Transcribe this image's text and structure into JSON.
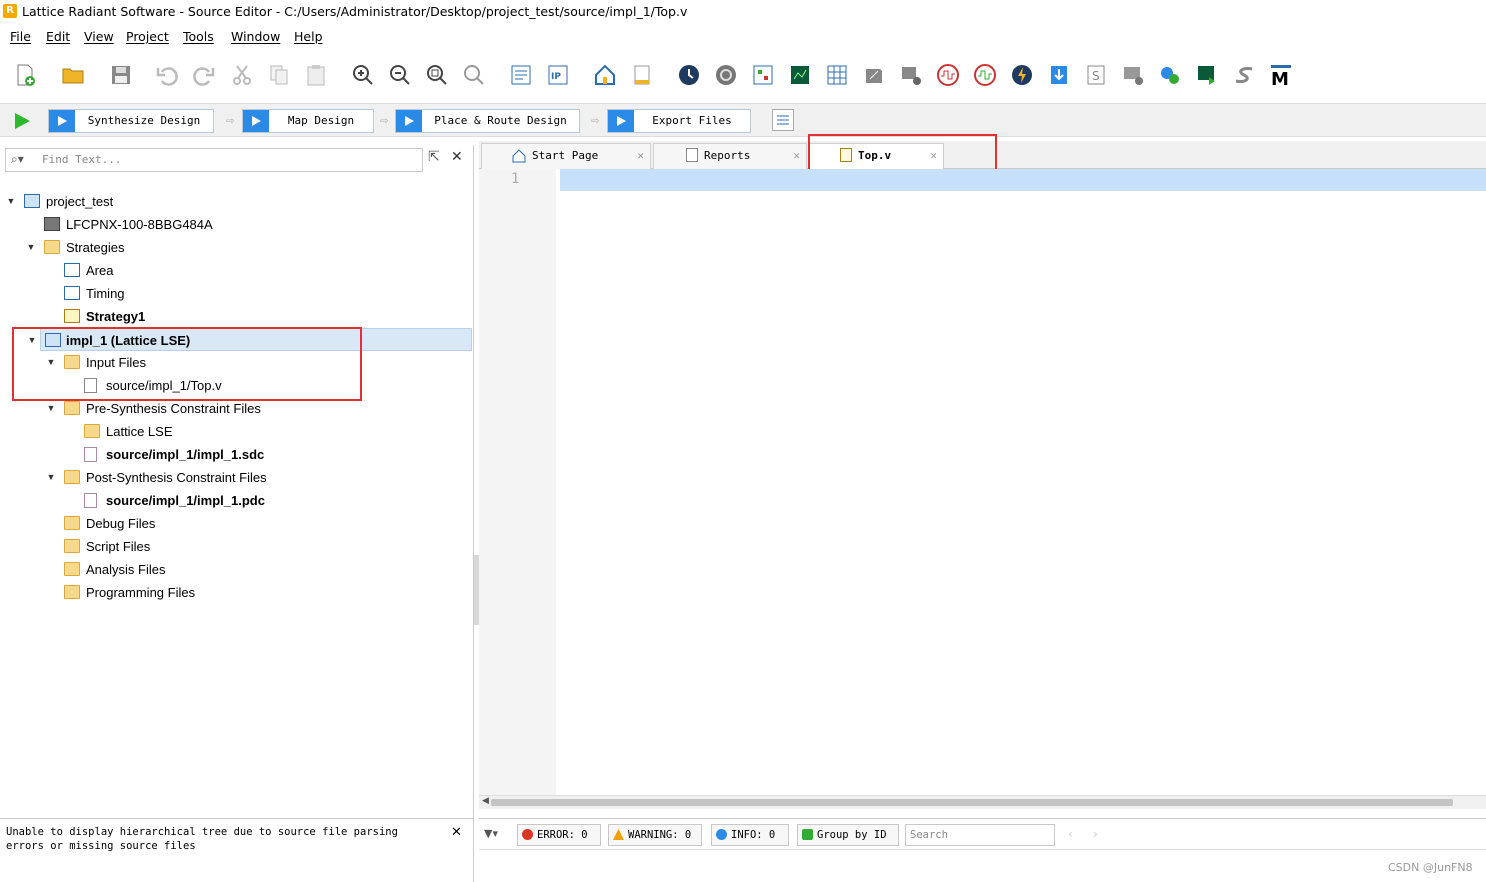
{
  "window": {
    "title": "Lattice Radiant Software - Source Editor - C:/Users/Administrator/Desktop/project_test/source/impl_1/Top.v",
    "logo_letter": "R"
  },
  "menu": [
    "File",
    "Edit",
    "View",
    "Project",
    "Tools",
    "Window",
    "Help"
  ],
  "flow": {
    "steps": [
      "Synthesize Design",
      "Map Design",
      "Place & Route Design",
      "Export Files"
    ]
  },
  "left": {
    "search_placeholder": "Find Text...",
    "tree": {
      "project": "project_test",
      "device": "LFCPNX-100-8BBG484A",
      "strategies": "Strategies",
      "area": "Area",
      "timing": "Timing",
      "strategy1": "Strategy1",
      "impl": "impl_1 (Lattice LSE)",
      "input_files": "Input Files",
      "top_v": "source/impl_1/Top.v",
      "pre_syn": "Pre-Synthesis Constraint Files",
      "lattice_lse": "Lattice LSE",
      "sdc": "source/impl_1/impl_1.sdc",
      "post_syn": "Post-Synthesis Constraint Files",
      "pdc": "source/impl_1/impl_1.pdc",
      "debug": "Debug Files",
      "script": "Script Files",
      "analysis": "Analysis Files",
      "programming": "Programming Files"
    },
    "message": "Unable to display hierarchical tree due to source file parsing errors or missing source files"
  },
  "editor": {
    "tabs": [
      "Start Page",
      "Reports",
      "Top.v"
    ],
    "active_tab": "Top.v",
    "line_number": "1"
  },
  "bottom": {
    "error": "ERROR: 0",
    "warning": "WARNING: 0",
    "info": "INFO: 0",
    "group": "Group by ID",
    "search_placeholder": "Search"
  },
  "watermark": "CSDN @JunFN8"
}
